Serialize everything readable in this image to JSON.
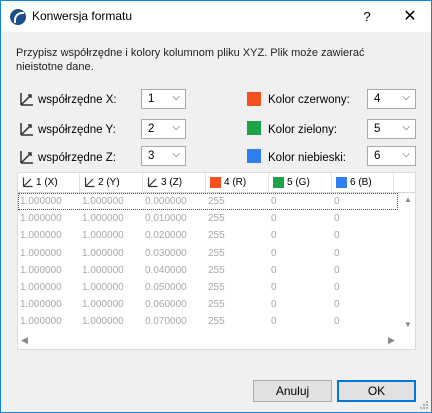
{
  "window": {
    "title": "Konwersja formatu",
    "help_label": "?",
    "close_label": "✕"
  },
  "description": "Przypisz współrzędne i kolory kolumnom pliku XYZ. Plik może zawierać nieistotne dane.",
  "coords": [
    {
      "label": "współrzędne X:",
      "value": "1"
    },
    {
      "label": "współrzędne Y:",
      "value": "2"
    },
    {
      "label": "współrzędne Z:",
      "value": "3"
    }
  ],
  "colors": [
    {
      "label": "Kolor czerwony:",
      "value": "4",
      "swatch": "#f4511e"
    },
    {
      "label": "Kolor zielony:",
      "value": "5",
      "swatch": "#1fa34a"
    },
    {
      "label": "Kolor niebieski:",
      "value": "6",
      "swatch": "#2f7ff0"
    }
  ],
  "table": {
    "headers": [
      "1 (X)",
      "2 (Y)",
      "3 (Z)",
      "4 (R)",
      "5 (G)",
      "6 (B)"
    ],
    "header_swatches": [
      "",
      "",
      "",
      "#f4511e",
      "#1fa34a",
      "#2f7ff0"
    ],
    "rows": [
      [
        "1.000000",
        "1.000000",
        "0.000000",
        "255",
        "0",
        "0"
      ],
      [
        "1.000000",
        "1.000000",
        "0.010000",
        "255",
        "0",
        "0"
      ],
      [
        "1.000000",
        "1.000000",
        "0.020000",
        "255",
        "0",
        "0"
      ],
      [
        "1.000000",
        "1.000000",
        "0.030000",
        "255",
        "0",
        "0"
      ],
      [
        "1.000000",
        "1.000000",
        "0.040000",
        "255",
        "0",
        "0"
      ],
      [
        "1.000000",
        "1.000000",
        "0.050000",
        "255",
        "0",
        "0"
      ],
      [
        "1.000000",
        "1.000000",
        "0.060000",
        "255",
        "0",
        "0"
      ],
      [
        "1.000000",
        "1.000000",
        "0.070000",
        "255",
        "0",
        "0"
      ]
    ]
  },
  "buttons": {
    "cancel": "Anuluj",
    "ok": "OK"
  },
  "scroll_glyphs": {
    "up": "▲",
    "down": "▼",
    "left": "◀",
    "right": "▶",
    "chevron": "⌵"
  }
}
